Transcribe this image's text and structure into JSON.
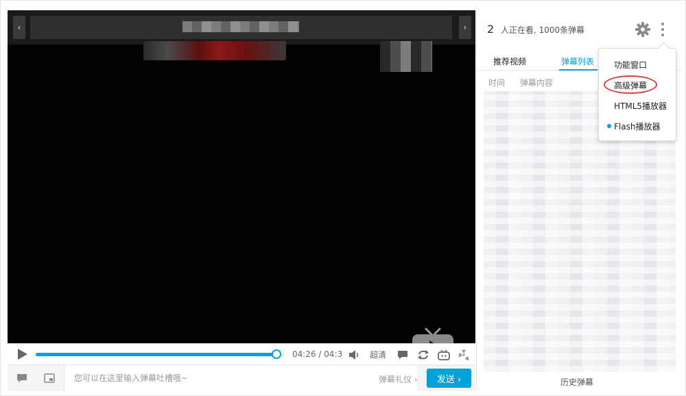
{
  "player": {
    "prev_glyph": "‹",
    "next_glyph": "›",
    "time_current": "04:26",
    "time_separator": "/",
    "time_total": "04:3",
    "progress_fraction": 0.97,
    "quality_label": "超清",
    "danmaku_placeholder": "您可以在这里输入弹幕吐槽哦~",
    "etiquette_label": "弹幕礼仪 ›",
    "send_label": "发送 ›"
  },
  "panel": {
    "viewer_count": "2",
    "viewer_text": "人正在看, 1000条弹幕",
    "tabs": [
      {
        "label": "推荐视频"
      },
      {
        "label": "弹幕列表"
      }
    ],
    "active_tab": 1,
    "columns": [
      "时间",
      "弹幕内容"
    ],
    "history_label": "历史弹幕"
  },
  "menu": {
    "items": [
      {
        "label": "功能窗口"
      },
      {
        "label": "高级弹幕"
      },
      {
        "label": "HTML5播放器"
      },
      {
        "label": "Flash播放器"
      }
    ],
    "selected_index": 3,
    "highlighted_index": 1
  },
  "colors": {
    "accent": "#00a1d6",
    "annotation_ring": "#d9403a"
  }
}
